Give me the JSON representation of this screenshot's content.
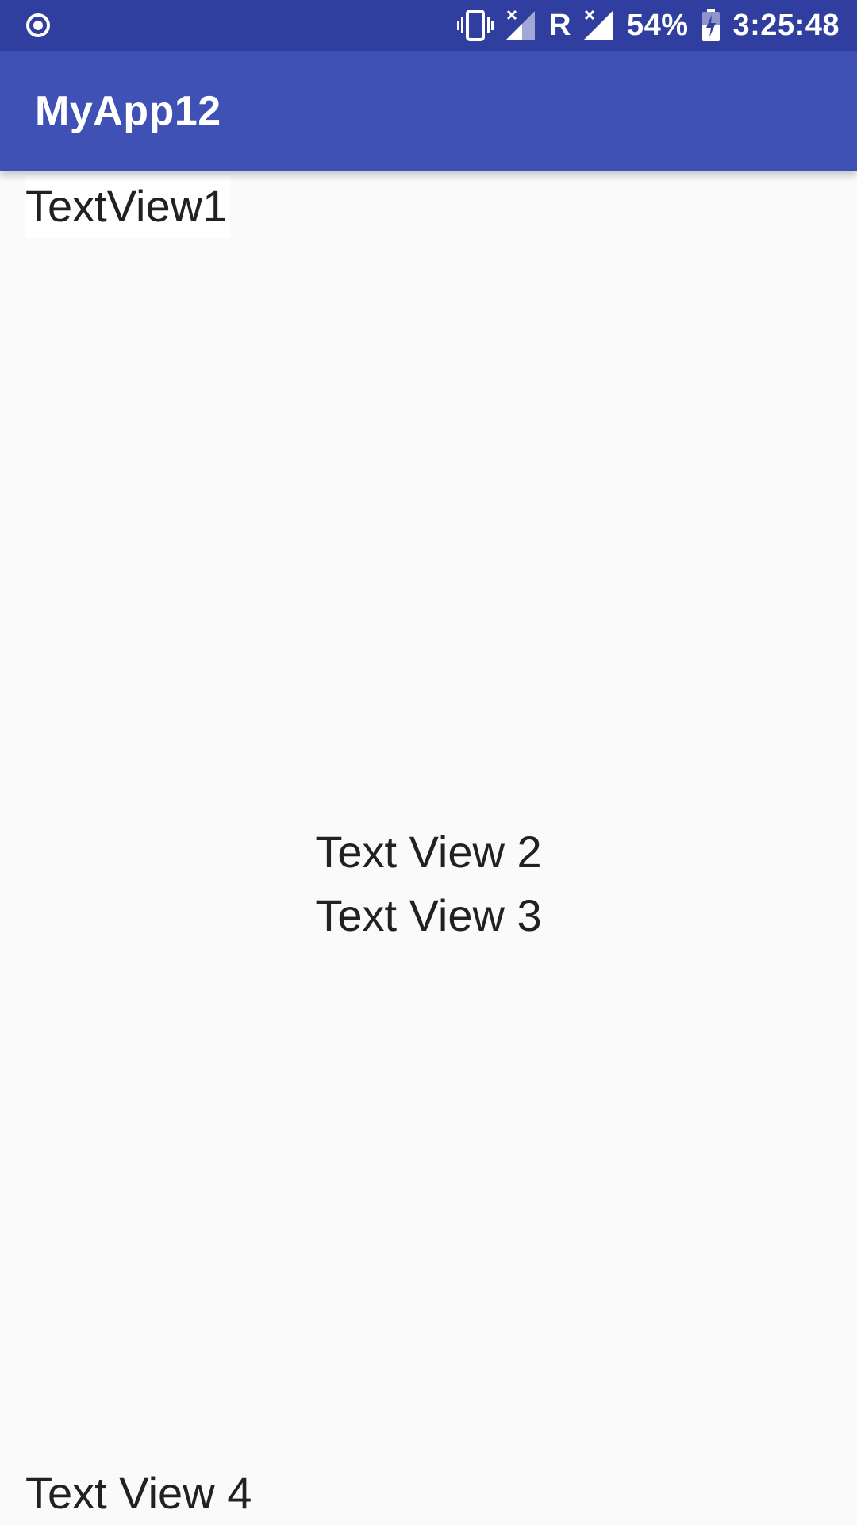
{
  "status_bar": {
    "battery": "54%",
    "time": "3:25:48",
    "roaming_label": "R",
    "icons": [
      "record-icon",
      "vibrate-icon",
      "signal-no-service-icon",
      "signal-icon",
      "battery-charging-icon"
    ],
    "background_color": "#303f9f"
  },
  "app_bar": {
    "title": "MyApp12",
    "background_color": "#3f51b5"
  },
  "content": {
    "text_view_1": "TextView1",
    "text_view_2": "Text View 2",
    "text_view_3": "Text View 3",
    "text_view_4": "Text View 4"
  }
}
